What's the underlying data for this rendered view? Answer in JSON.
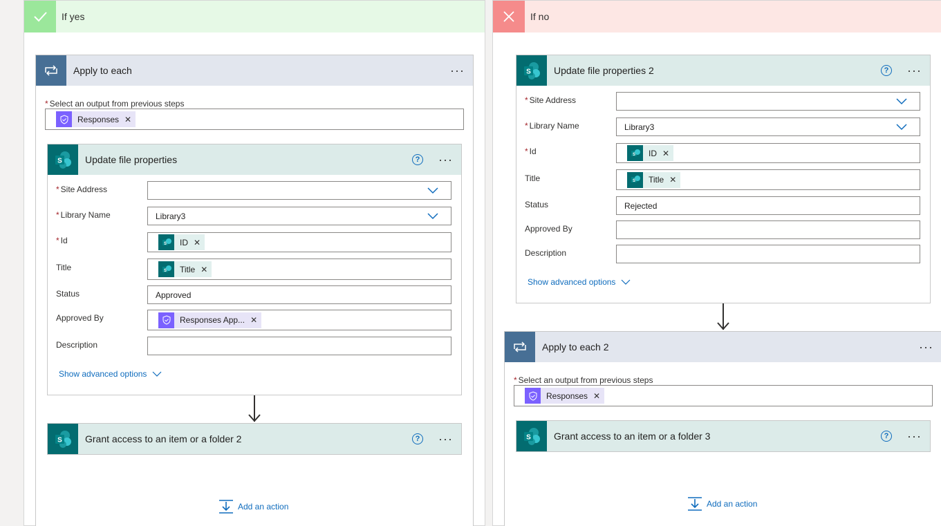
{
  "branches": {
    "yes": {
      "title": "If yes",
      "color": "#9be79b",
      "header_bg": "#e6f9e6"
    },
    "no": {
      "title": "If no",
      "color": "#f58b8b",
      "header_bg": "#fde7e4"
    }
  },
  "yes": {
    "loop": {
      "title": "Apply to each",
      "select_label": "Select an output from previous steps",
      "token": "Responses"
    },
    "update": {
      "title": "Update file properties",
      "fields": {
        "site_address": {
          "label": "Site Address",
          "value": ""
        },
        "library_name": {
          "label": "Library Name",
          "value": "Library3"
        },
        "id": {
          "label": "Id",
          "token": "ID"
        },
        "title": {
          "label": "Title",
          "token": "Title"
        },
        "status": {
          "label": "Status",
          "value": "Approved"
        },
        "approved_by": {
          "label": "Approved By",
          "token": "Responses App..."
        },
        "description": {
          "label": "Description",
          "value": ""
        }
      },
      "advanced": "Show advanced options"
    },
    "grant": {
      "title": "Grant access to an item or a folder 2"
    },
    "add_action": "Add an action"
  },
  "no": {
    "update": {
      "title": "Update file properties 2",
      "fields": {
        "site_address": {
          "label": "Site Address",
          "value": ""
        },
        "library_name": {
          "label": "Library Name",
          "value": "Library3"
        },
        "id": {
          "label": "Id",
          "token": "ID"
        },
        "title": {
          "label": "Title",
          "token": "Title"
        },
        "status": {
          "label": "Status",
          "value": "Rejected"
        },
        "approved_by": {
          "label": "Approved By",
          "value": ""
        },
        "description": {
          "label": "Description",
          "value": ""
        }
      },
      "advanced": "Show advanced options"
    },
    "loop": {
      "title": "Apply to each 2",
      "select_label": "Select an output from previous steps",
      "token": "Responses"
    },
    "grant": {
      "title": "Grant access to an item or a folder 3"
    },
    "add_action": "Add an action"
  },
  "icons": {
    "more": "more-icon",
    "help": "help-icon",
    "sharepoint": "sharepoint-icon",
    "loop": "loop-icon",
    "approvals": "approvals-icon",
    "check": "check-icon",
    "close": "close-icon",
    "add_action": "add-action-icon"
  }
}
